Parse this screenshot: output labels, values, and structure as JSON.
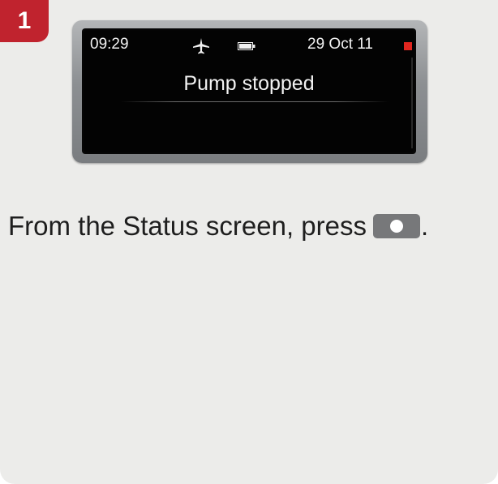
{
  "step": {
    "number": "1"
  },
  "device_screen": {
    "time": "09:29",
    "icons": [
      "airplane-icon",
      "battery-icon"
    ],
    "date": "29 Oct 11",
    "alert_indicator_color": "#e0261f",
    "message": "Pump stopped"
  },
  "instruction": {
    "text": "From the Status screen, press",
    "button_icon": "select-key-icon",
    "trailing": "."
  },
  "colors": {
    "badge": "#c0232e",
    "card_background": "#ececea",
    "screen_background": "#030303",
    "key_fill": "#77787a"
  }
}
